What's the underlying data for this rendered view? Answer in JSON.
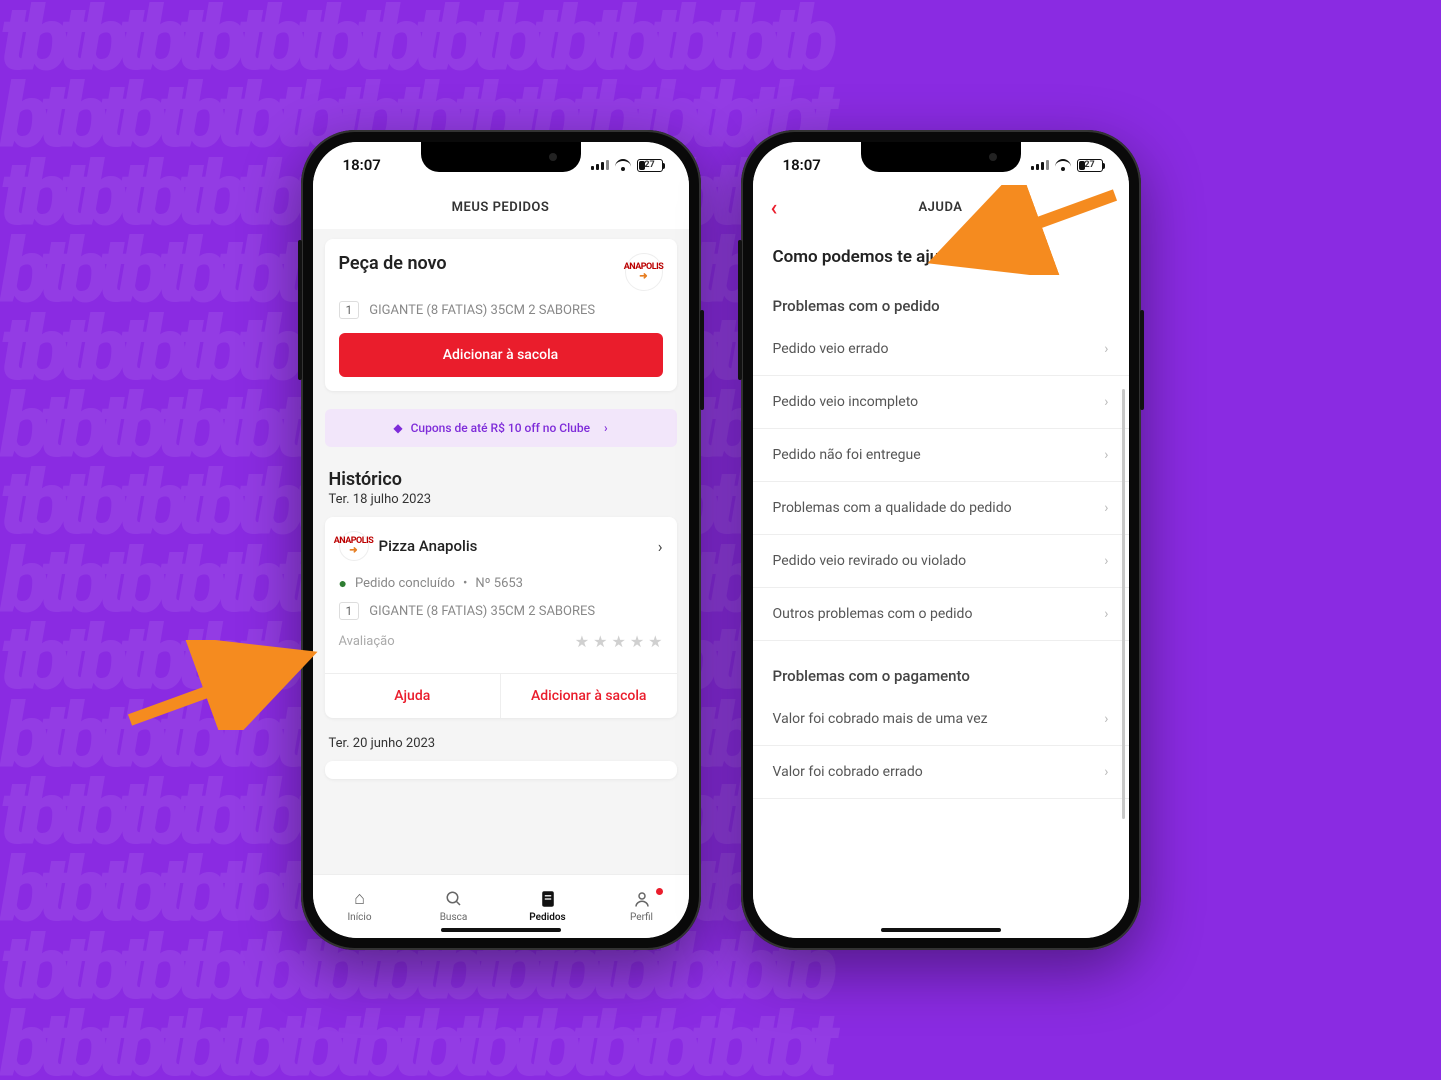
{
  "status": {
    "time": "18:07",
    "battery": "27"
  },
  "left": {
    "title": "MEUS PEDIDOS",
    "reorder": {
      "heading": "Peça de novo",
      "qty": "1",
      "item": "GIGANTE (8 FATIAS) 35CM 2 SABORES",
      "brand": "ANAPOLIS",
      "cta": "Adicionar à sacola"
    },
    "promo": "Cupons de até R$ 10 off no Clube",
    "history": {
      "heading": "Histórico",
      "date1": "Ter. 18 julho 2023",
      "restaurant": "Pizza Anapolis",
      "status": "Pedido concluído",
      "orderNo": "Nº 5653",
      "qty": "1",
      "item": "GIGANTE (8 FATIAS) 35CM 2 SABORES",
      "ratingLabel": "Avaliação",
      "help": "Ajuda",
      "addBag": "Adicionar à sacola",
      "date2": "Ter. 20 junho 2023"
    },
    "tabs": {
      "home": "Início",
      "search": "Busca",
      "orders": "Pedidos",
      "profile": "Perfil"
    }
  },
  "right": {
    "title": "AJUDA",
    "heading": "Como podemos te ajudar?",
    "group1": "Problemas com o pedido",
    "items1": [
      "Pedido veio errado",
      "Pedido veio incompleto",
      "Pedido não foi entregue",
      "Problemas com a qualidade do pedido",
      "Pedido veio revirado ou violado",
      "Outros problemas com o pedido"
    ],
    "group2": "Problemas com o pagamento",
    "items2": [
      "Valor foi cobrado mais de uma vez",
      "Valor foi cobrado errado"
    ]
  }
}
